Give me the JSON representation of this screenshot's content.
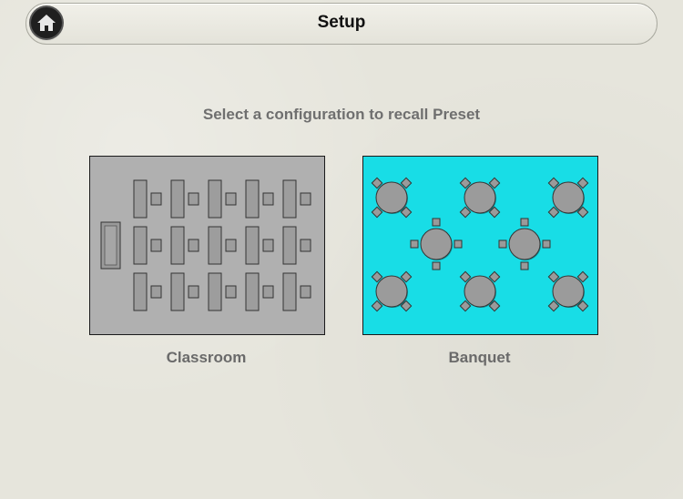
{
  "header": {
    "title": "Setup"
  },
  "home": {
    "icon": "home-icon"
  },
  "prompt": "Select a configuration to recall Preset",
  "presets": [
    {
      "label": "Classroom",
      "color": "#b0b0b0"
    },
    {
      "label": "Banquet",
      "color": "#18dde6"
    }
  ]
}
